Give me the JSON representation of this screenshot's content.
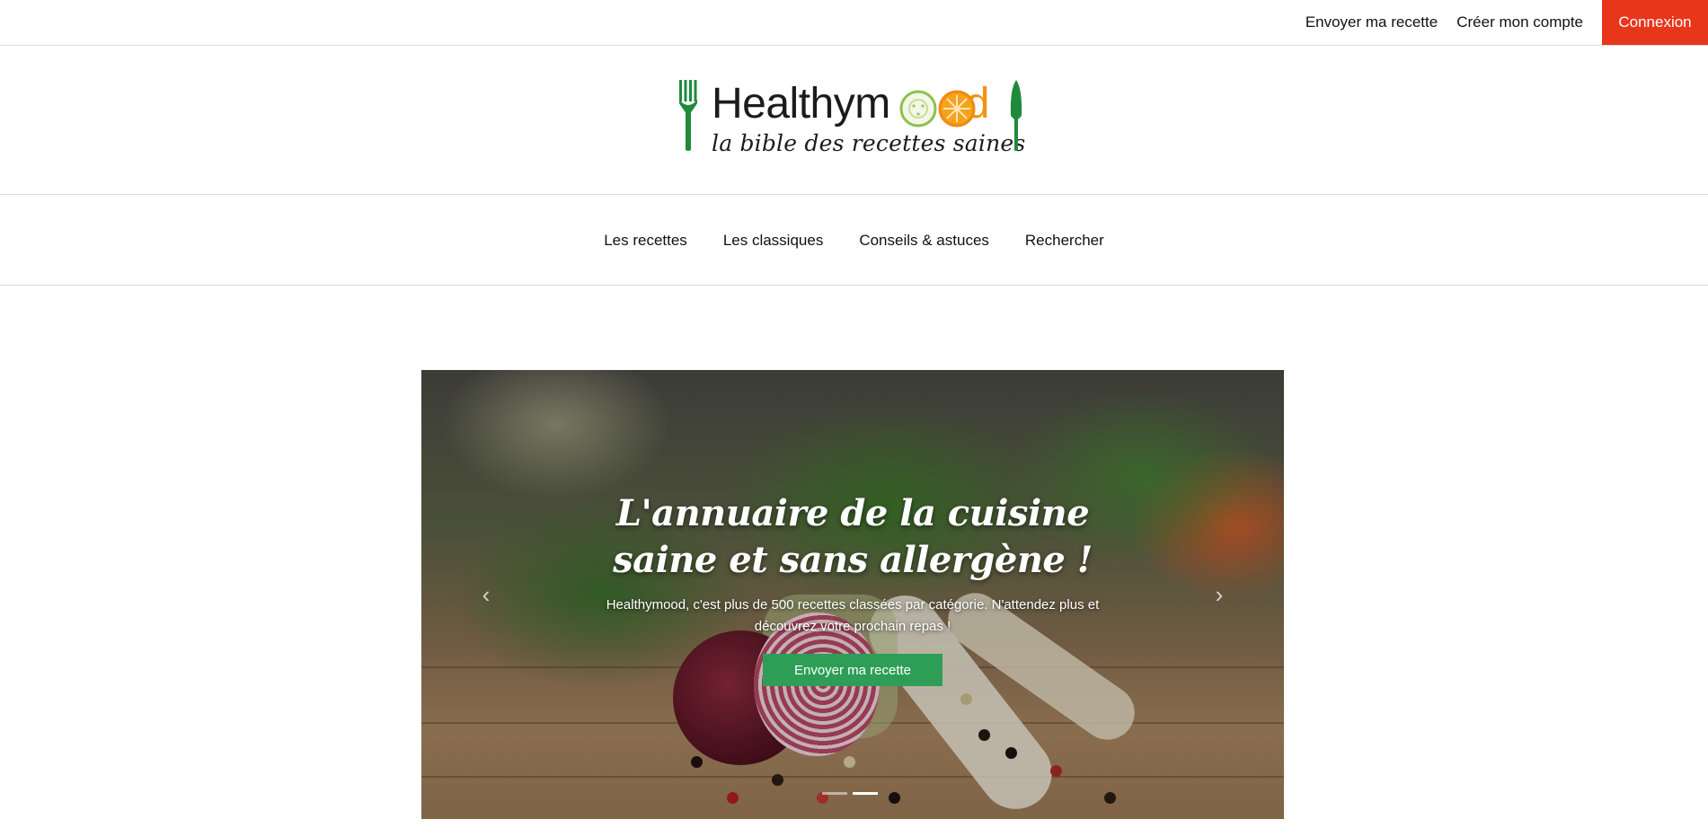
{
  "topbar": {
    "submit_recipe": "Envoyer ma recette",
    "create_account": "Créer mon compte",
    "login": "Connexion"
  },
  "logo": {
    "word_part1": "Healthym",
    "word_part2": "d",
    "tagline": "la bible des recettes saines"
  },
  "nav": {
    "items": [
      "Les recettes",
      "Les classiques",
      "Conseils & astuces",
      "Rechercher"
    ]
  },
  "hero": {
    "title": "L'annuaire de la cuisine saine et sans allergène !",
    "text": "Healthymood, c'est plus de 500 recettes classées par catégorie. N'attendez plus et découvrez votre prochain repas !",
    "button_label": "Envoyer ma recette",
    "slide_count": 2,
    "active_slide": 2
  },
  "colors": {
    "login_bg": "#e8361b",
    "button_green": "#2e9e57",
    "logo_orange": "#f39214",
    "logo_green": "#1f8a3b"
  },
  "icons": {
    "prev": "chevron-left-icon",
    "next": "chevron-right-icon"
  }
}
